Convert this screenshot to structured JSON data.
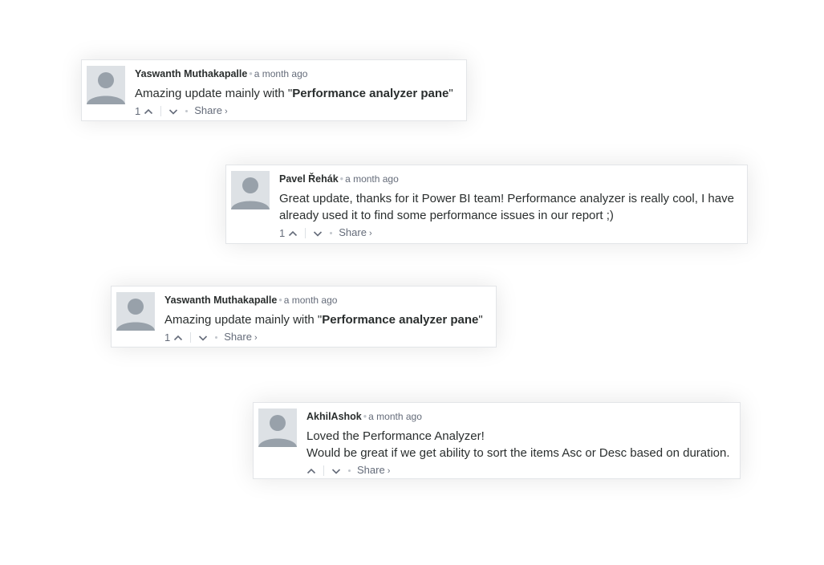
{
  "comments": [
    {
      "author": "Yaswanth Muthakapalle",
      "time": "a month ago",
      "body_parts": [
        "Amazing update mainly with \"",
        "Performance analyzer pane",
        "\""
      ],
      "votes": "1",
      "share_label": "Share",
      "share_chevron": "›",
      "separator": "•"
    },
    {
      "author": "Pavel Řehák",
      "time": "a month ago",
      "body_lines": [
        "Great update, thanks for it Power BI team! Performance analyzer is really cool, I have already used it to find some performance issues in our report ;)"
      ],
      "votes": "1",
      "share_label": "Share",
      "share_chevron": "›",
      "separator": "•"
    },
    {
      "author": "Yaswanth Muthakapalle",
      "time": "a month ago",
      "body_parts": [
        "Amazing update mainly with \"",
        "Performance analyzer pane",
        "\""
      ],
      "votes": "1",
      "share_label": "Share",
      "share_chevron": "›",
      "separator": "•"
    },
    {
      "author": "AkhilAshok",
      "time": "a month ago",
      "body_lines": [
        "Loved the Performance Analyzer!",
        "Would be great if we get ability to sort the items Asc or Desc based on duration."
      ],
      "votes": "",
      "share_label": "Share",
      "share_chevron": "›",
      "separator": "•"
    }
  ],
  "colors": {
    "author": "#2a2e2e",
    "meta": "#656c7a",
    "avatar_bg": "#dde1e5",
    "avatar_fg": "#98a1aa"
  },
  "icons": {
    "avatar": "default-user-avatar-icon",
    "upvote": "chevron-up-icon",
    "downvote": "chevron-down-icon"
  }
}
